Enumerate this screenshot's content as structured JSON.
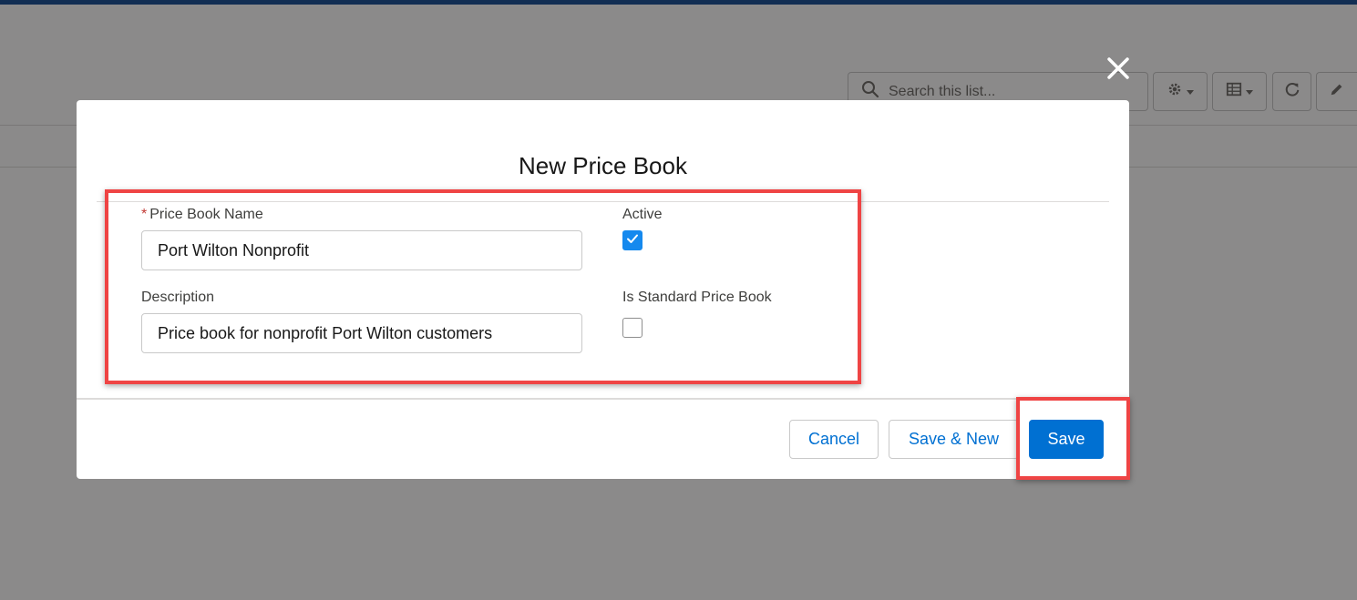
{
  "background": {
    "search_placeholder": "Search this list..."
  },
  "modal": {
    "title": "New Price Book",
    "fields": {
      "name_required_mark": "*",
      "name_label": "Price Book Name",
      "name_value": "Port Wilton Nonprofit",
      "description_label": "Description",
      "description_value": "Price book for nonprofit Port Wilton customers",
      "active_label": "Active",
      "active_checked": true,
      "standard_label": "Is Standard Price Book",
      "standard_checked": false
    },
    "buttons": {
      "cancel": "Cancel",
      "save_new": "Save & New",
      "save": "Save"
    }
  },
  "colors": {
    "brand": "#0070d2",
    "checkbox_checked": "#1589ee",
    "required": "#c23934",
    "highlight": "#ef4444"
  }
}
